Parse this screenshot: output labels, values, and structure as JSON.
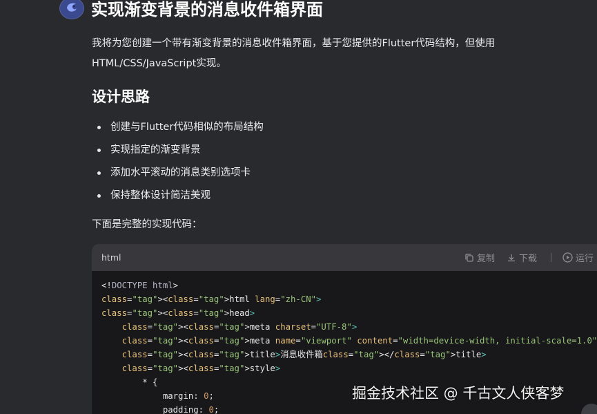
{
  "header": {
    "title": "实现渐变背景的消息收件箱界面",
    "avatar_icon": "assistant-logo-icon"
  },
  "intro": "我将为您创建一个带有渐变背景的消息收件箱界面，基于您提供的Flutter代码结构，但使用HTML/CSS/JavaScript实现。",
  "design": {
    "heading": "设计思路",
    "bullets": [
      "创建与Flutter代码相似的布局结构",
      "实现指定的渐变背景",
      "添加水平滚动的消息类别选项卡",
      "保持整体设计简洁美观"
    ]
  },
  "lead": "下面是完整的实现代码：",
  "codeblock": {
    "language": "html",
    "copy_label": "复制",
    "download_label": "下载",
    "run_label": "运行",
    "lines": [
      "<!DOCTYPE html>",
      "<html lang=\"zh-CN\">",
      "<head>",
      "    <meta charset=\"UTF-8\">",
      "    <meta name=\"viewport\" content=\"width=device-width, initial-scale=1.0\">",
      "    <title>消息收件箱</title>",
      "    <style>",
      "        * {",
      "            margin: 0;",
      "            padding: 0;"
    ]
  },
  "watermark": "掘金技术社区 @ 千古文人侠客梦"
}
